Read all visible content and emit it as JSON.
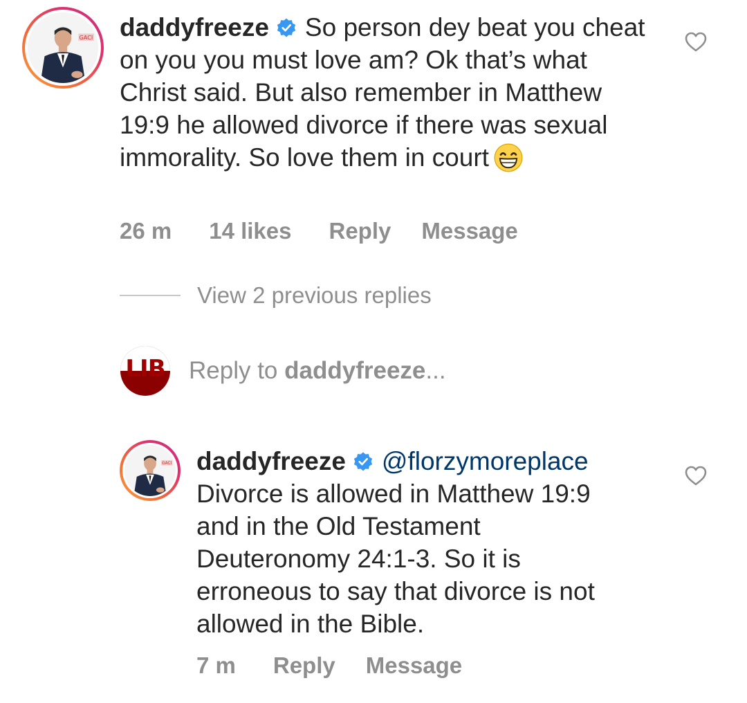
{
  "comment": {
    "username": "daddyfreeze",
    "text": "So person dey beat you cheat on you you must love am? Ok that’s what Christ said. But also remember in Matthew 19:9 he allowed divorce if there was sexual immorality. So love them in court",
    "emoji": "grinning-face-emoji",
    "time": "26 m",
    "likes": "14 likes",
    "reply_label": "Reply",
    "message_label": "Message"
  },
  "view_replies_label": "View 2 previous replies",
  "composer": {
    "avatar_text": "LIB",
    "prefix": "Reply to",
    "target": "daddyfreeze",
    "suffix": "..."
  },
  "reply": {
    "username": "daddyfreeze",
    "mention": "@florzymoreplace",
    "text": "Divorce is allowed in Matthew 19:9 and in the Old Testament Deuteronomy 24:1-3. So it is erroneous to say that divorce is not allowed in the Bible.",
    "time": "7 m",
    "reply_label": "Reply",
    "message_label": "Message"
  },
  "icons": {
    "verified": "verified-badge-icon",
    "like": "heart-outline-icon"
  },
  "colors": {
    "text": "#262626",
    "meta": "#8e8e8e",
    "mention": "#00376b",
    "verified": "#3897f0"
  }
}
